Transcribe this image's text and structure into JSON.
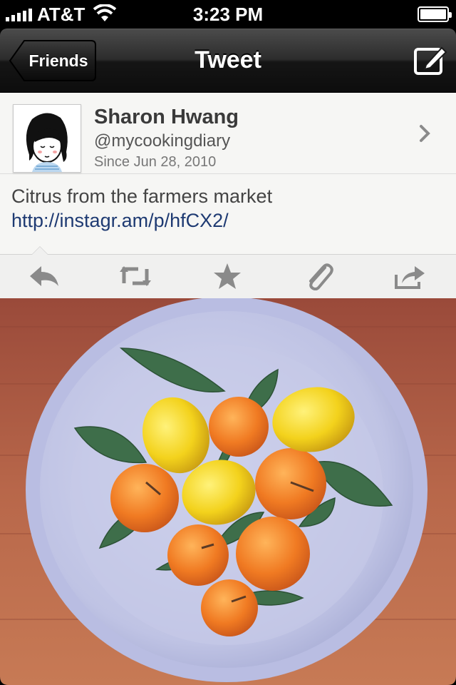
{
  "status_bar": {
    "carrier": "AT&T",
    "time": "3:23 PM",
    "icons": [
      "signal-icon",
      "wifi-icon",
      "battery-icon"
    ]
  },
  "nav_bar": {
    "back_label": "Friends",
    "title": "Tweet",
    "compose_icon": "compose-icon"
  },
  "tweet": {
    "author_name": "Sharon Hwang",
    "author_handle": "@mycookingdiary",
    "since": "Since Jun 28, 2010",
    "text": "Citrus from the farmers market ",
    "link": "http://instagr.am/p/hfCX2/"
  },
  "actions": [
    {
      "name": "reply",
      "icon": "reply-icon"
    },
    {
      "name": "retweet",
      "icon": "retweet-icon"
    },
    {
      "name": "favorite",
      "icon": "star-icon"
    },
    {
      "name": "attach",
      "icon": "paperclip-icon"
    },
    {
      "name": "share",
      "icon": "share-icon"
    }
  ],
  "colors": {
    "nav_bar": "#1a1a1a",
    "card_background": "#f6f6f4",
    "link": "#1e3a72",
    "icon_gray": "#8a8a8a",
    "plate": "#c9cde9",
    "wood": "#a8553c"
  }
}
